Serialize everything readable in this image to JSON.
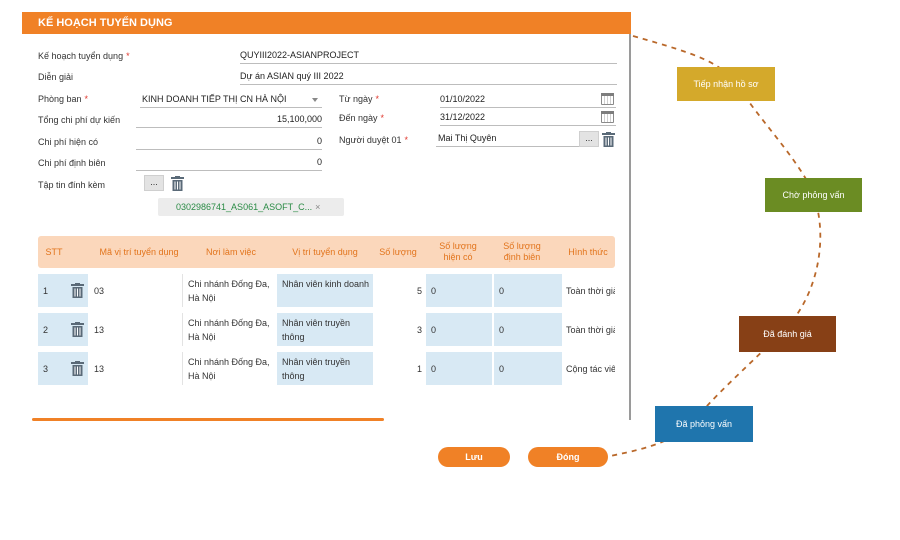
{
  "dialog": {
    "title": "KẾ HOẠCH TUYỂN DỤNG",
    "accent_color": "#f08126"
  },
  "form": {
    "plan_label": "Kế hoạch tuyển dụng",
    "plan_value": "QUYIII2022-ASIANPROJECT",
    "desc_label": "Diễn giải",
    "desc_value": "Dự án ASIAN quý III 2022",
    "department_label": "Phòng ban",
    "department_value": "KINH DOANH TIẾP THỊ CN HÀ NỘI",
    "total_cost_label": "Tổng chi phí dự kiến",
    "total_cost_value": "15,100,000",
    "current_cost_label": "Chi phí hiện có",
    "current_cost_value": "0",
    "staff_cost_label": "Chi phí định biên",
    "staff_cost_value": "0",
    "attachment_label": "Tập tin đính kèm",
    "attachment_file": "0302986741_AS061_ASOFT_C...",
    "browse_label": "...",
    "from_label": "Từ ngày",
    "from_value": "01/10/2022",
    "to_label": "Đến ngày",
    "to_value": "31/12/2022",
    "approver_label": "Người duyệt 01",
    "approver_value": "Mai Thị Quyên",
    "required_mark": "*",
    "chip_close": "×"
  },
  "table": {
    "headers": [
      "STT",
      "Mã vị trí tuyển dụng",
      "Nơi làm việc",
      "Vị trí tuyển dụng",
      "Số lượng",
      "Số lượng hiện có",
      "Số lượng định biên",
      "Hình thức"
    ],
    "rows": [
      {
        "stt": "1",
        "code": "03",
        "place": "Chi nhánh Đống Đa, Hà Nội",
        "position": "Nhân viên kinh doanh",
        "qty": "5",
        "current": "0",
        "staffing": "0",
        "type": "Toàn thời giả"
      },
      {
        "stt": "2",
        "code": "13",
        "place": "Chi nhánh Đống Đa, Hà Nội",
        "position": "Nhân viên truyền thông",
        "qty": "3",
        "current": "0",
        "staffing": "0",
        "type": "Toàn thời giả"
      },
      {
        "stt": "3",
        "code": "13",
        "place": "Chi nhánh Đống Đa, Hà Nội",
        "position": "Nhân viên truyền thông",
        "qty": "1",
        "current": "0",
        "staffing": "0",
        "type": "Cộng tác viê"
      }
    ]
  },
  "buttons": {
    "save": "Lưu",
    "close": "Đóng"
  },
  "stages": [
    {
      "label": "Tiếp nhận hồ sơ",
      "color": "#d4a92b"
    },
    {
      "label": "Chờ phỏng vấn",
      "color": "#6b8c23"
    },
    {
      "label": "Đã đánh giá",
      "color": "#874016"
    },
    {
      "label": "Đã phỏng vấn",
      "color": "#1f75ad"
    }
  ],
  "icons": {
    "trash": "trash-icon",
    "calendar": "calendar-icon",
    "dropdown": "chevron-down-icon"
  }
}
